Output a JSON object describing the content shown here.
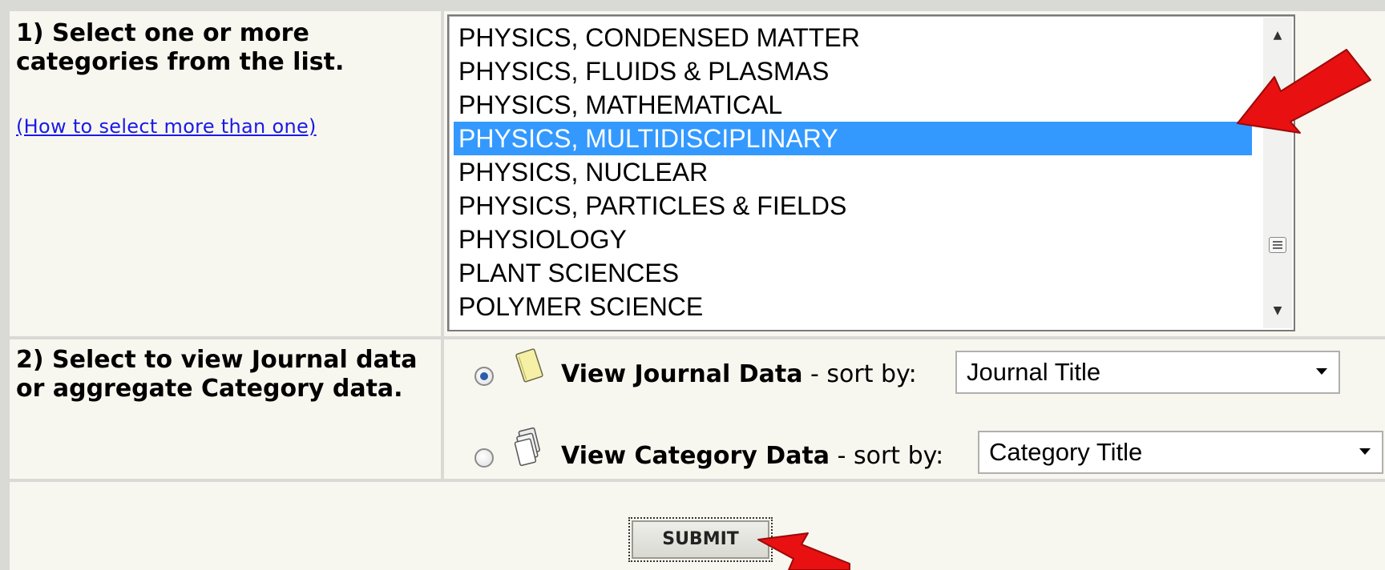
{
  "step1": {
    "label": "1) Select one or more categories from the list.",
    "help_link": "(How to select more than one)"
  },
  "category_list": {
    "items": [
      "PHYSICS, CONDENSED MATTER",
      "PHYSICS, FLUIDS & PLASMAS",
      "PHYSICS, MATHEMATICAL",
      "PHYSICS, MULTIDISCIPLINARY",
      "PHYSICS, NUCLEAR",
      "PHYSICS, PARTICLES & FIELDS",
      "PHYSIOLOGY",
      "PLANT SCIENCES",
      "POLYMER SCIENCE"
    ],
    "selected": "PHYSICS, MULTIDISCIPLINARY",
    "selection_color": "#3399ff"
  },
  "step2": {
    "label": "2) Select to view Journal data or aggregate Category data.",
    "journal": {
      "title": "View Journal Data",
      "sort_text": "- sort by:",
      "sort_value": "Journal Title",
      "checked": true
    },
    "category": {
      "title": "View Category Data",
      "sort_text": "- sort by:",
      "sort_value": "Category Title",
      "checked": false
    }
  },
  "submit": {
    "label": "SUBMIT"
  },
  "annotations": {
    "arrow_color": "#e81010",
    "icons": [
      "listbox-arrow-icon",
      "submit-arrow-icon"
    ]
  }
}
